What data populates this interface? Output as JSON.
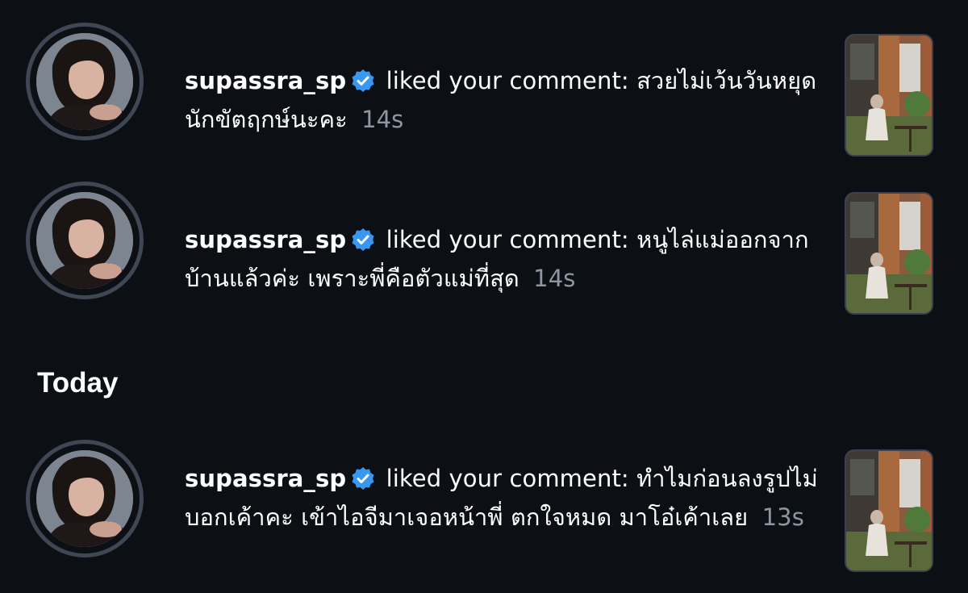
{
  "section_header": "Today",
  "notifications": [
    {
      "username": "supassra_sp",
      "verified": true,
      "action": "liked your comment:",
      "comment": "สวยไม่เว้นวันหยุดนักขัตฤกษ์นะคะ",
      "time": "14s"
    },
    {
      "username": "supassra_sp",
      "verified": true,
      "action": "liked your comment:",
      "comment": "หนูไล่แม่ออกจากบ้านแล้วค่ะ เพราะพี่คือตัวแม่ที่สุด",
      "time": "14s"
    },
    {
      "username": "supassra_sp",
      "verified": true,
      "action": "liked your comment:",
      "comment": "ทำไมก่อนลงรูปไม่บอกเค้าคะ เข้าไอจีมาเจอหน้าพี่ ตกใจหมด มาโอ๋เค้าเลย",
      "time": "13s"
    }
  ],
  "colors": {
    "background": "#0c0f14",
    "text": "#ffffff",
    "muted": "#8f96a3",
    "verified_badge": "#3897f0",
    "ring": "#3f4654"
  }
}
